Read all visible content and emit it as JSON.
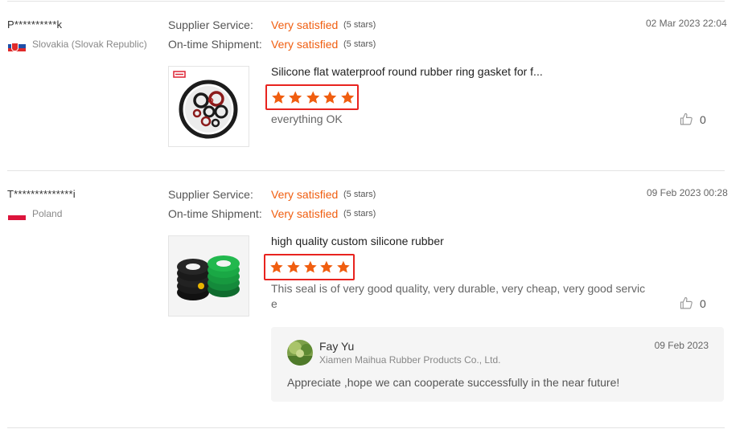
{
  "reviews": [
    {
      "user": "P**********k",
      "country": "Slovakia (Slovak Republic)",
      "supplier_service_label": "Supplier Service:",
      "supplier_service_value": "Very satisfied",
      "supplier_service_stars": "(5 stars)",
      "shipment_label": "On-time Shipment:",
      "shipment_value": "Very satisfied",
      "shipment_stars": "(5 stars)",
      "date": "02 Mar 2023 22:04",
      "product_title": "Silicone flat waterproof round rubber ring gasket for f...",
      "rating": 5,
      "text": "everything OK",
      "likes": "0"
    },
    {
      "user": "T**************i",
      "country": "Poland",
      "supplier_service_label": "Supplier Service:",
      "supplier_service_value": "Very satisfied",
      "supplier_service_stars": "(5 stars)",
      "shipment_label": "On-time Shipment:",
      "shipment_value": "Very satisfied",
      "shipment_stars": "(5 stars)",
      "date": "09 Feb 2023 00:28",
      "product_title": "high quality custom silicone rubber",
      "rating": 5,
      "text_line1": "This seal is of very good quality, very durable, very cheap, very good servic",
      "text_line2": "e",
      "likes": "0",
      "reply": {
        "name": "Fay Yu",
        "company": "Xiamen Maihua Rubber Products Co., Ltd.",
        "date": "09 Feb 2023",
        "message": "Appreciate ,hope we can  cooperate successfully in the near future!"
      }
    }
  ],
  "colors": {
    "accent_orange": "#f05e10",
    "highlight_red": "#e8231f",
    "divider": "#e3e3e3"
  },
  "icons": {
    "star": "star-icon",
    "like": "thumbs-up-icon"
  }
}
